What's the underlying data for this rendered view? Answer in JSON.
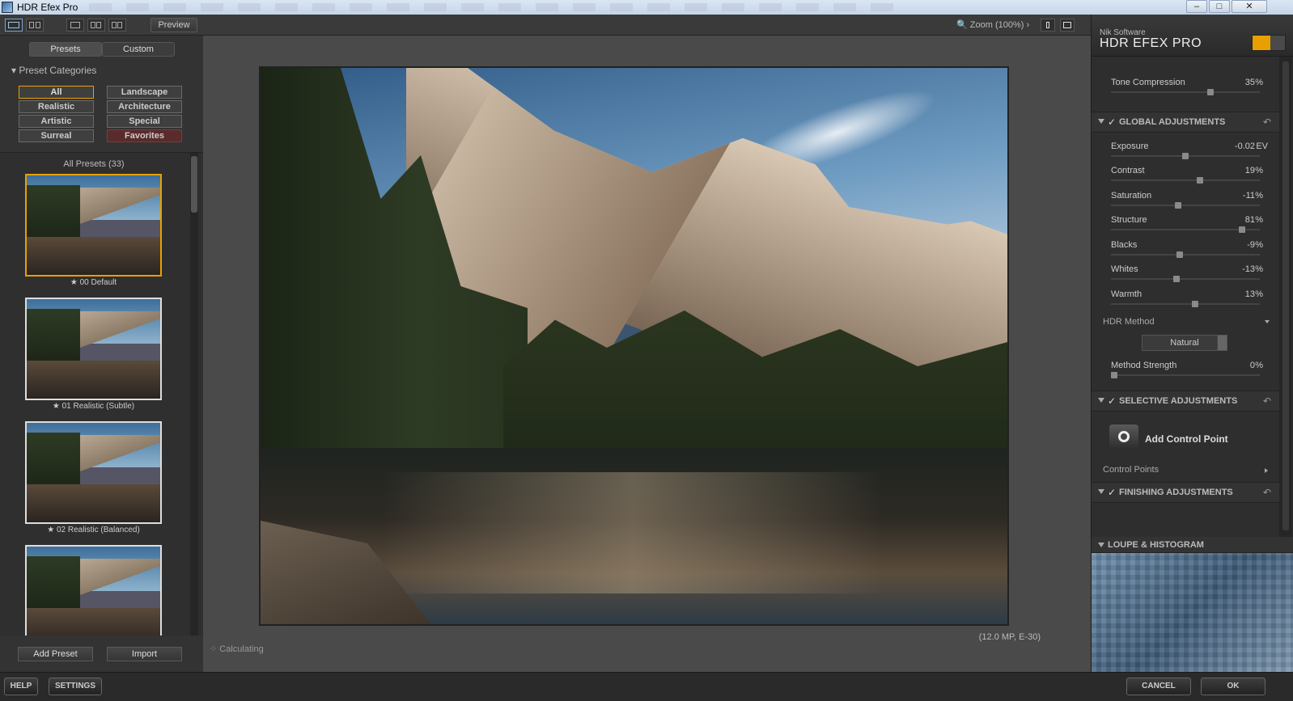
{
  "window": {
    "title": "HDR Efex Pro"
  },
  "toolbar": {
    "preview_label": "Preview",
    "zoom_label": "Zoom (100%)"
  },
  "left": {
    "tabs": [
      "Presets",
      "Custom"
    ],
    "category_header": "Preset Categories",
    "categories": [
      "All",
      "Landscape",
      "Realistic",
      "Architecture",
      "Artistic",
      "Special",
      "Surreal",
      "Favorites"
    ],
    "list_title": "All Presets (33)",
    "presets": [
      "★ 00 Default",
      "★ 01 Realistic (Subtle)",
      "★ 02 Realistic (Balanced)"
    ],
    "add_preset": "Add Preset",
    "import": "Import"
  },
  "center": {
    "status": "Calculating",
    "image_info": "(12.0 MP, E-30)"
  },
  "right": {
    "company": "Nik Software",
    "product": "HDR EFEX PRO",
    "tone_compression": {
      "label": "Tone Compression",
      "value": "35",
      "unit": "%",
      "level": 0.675
    },
    "global_title": "GLOBAL ADJUSTMENTS",
    "adjustments": [
      {
        "label": "Exposure",
        "value": "-0.02",
        "unit": "EV",
        "level": 0.5
      },
      {
        "label": "Contrast",
        "value": "19",
        "unit": "%",
        "level": 0.6
      },
      {
        "label": "Saturation",
        "value": "-11",
        "unit": "%",
        "level": 0.45
      },
      {
        "label": "Structure",
        "value": "81",
        "unit": "%",
        "level": 0.9
      },
      {
        "label": "Blacks",
        "value": "-9",
        "unit": "%",
        "level": 0.46
      },
      {
        "label": "Whites",
        "value": "-13",
        "unit": "%",
        "level": 0.44
      },
      {
        "label": "Warmth",
        "value": "13",
        "unit": "%",
        "level": 0.57
      }
    ],
    "hdr_method_label": "HDR Method",
    "hdr_method_value": "Natural",
    "method_strength": {
      "label": "Method Strength",
      "value": "0",
      "unit": "%",
      "level": 0.0
    },
    "selective_title": "SELECTIVE ADJUSTMENTS",
    "add_control_point": "Add Control Point",
    "control_points_label": "Control Points",
    "finishing_title": "FINISHING ADJUSTMENTS",
    "loupe_title": "LOUPE & HISTOGRAM"
  },
  "footer": {
    "help": "HELP",
    "settings": "SETTINGS",
    "cancel": "CANCEL",
    "ok": "OK"
  },
  "colors": {
    "accent": "#e8a000",
    "favorites": "#5a2b2b"
  }
}
